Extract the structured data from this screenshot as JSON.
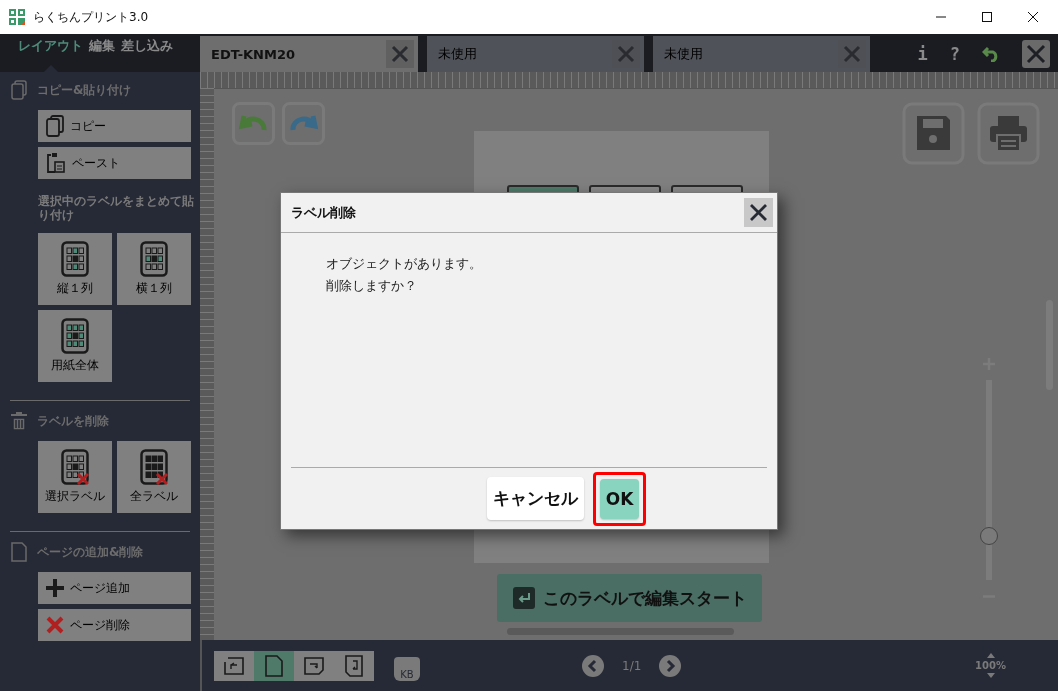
{
  "window": {
    "title": "らくちんプリント3.0"
  },
  "mode_tabs": [
    {
      "label": "レイアウト",
      "selected": true
    },
    {
      "label": "編集",
      "selected": false
    },
    {
      "label": "差し込み",
      "selected": false
    }
  ],
  "document_tabs": [
    {
      "label": "EDT-KNM20",
      "selected": true
    },
    {
      "label": "未使用",
      "selected": false
    },
    {
      "label": "未使用",
      "selected": false
    }
  ],
  "toolbar": [
    "i",
    "?"
  ],
  "sidebar": {
    "sections": [
      {
        "kind": "copy",
        "title": "コピー&貼り付け",
        "items": [
          {
            "kind": "copy",
            "label": "コピー"
          },
          {
            "kind": "paste",
            "label": "ペースト"
          },
          {
            "kind": "caption",
            "label": "選択中のラベルをまとめて貼り付け"
          },
          {
            "kind": "column",
            "label": "縦１列"
          },
          {
            "kind": "row",
            "label": "横１列"
          },
          {
            "kind": "sheet",
            "label": "用紙全体"
          }
        ]
      },
      {
        "kind": "delete",
        "title": "ラベルを削除",
        "items": [
          {
            "kind": "delete-selected",
            "label": "選択ラベル"
          },
          {
            "kind": "delete-all",
            "label": "全ラベル"
          }
        ]
      },
      {
        "kind": "page",
        "title": "ページの追加&削除",
        "items": [
          {
            "kind": "add-page",
            "label": "ページ追加"
          },
          {
            "kind": "delete-page",
            "label": "ページ削除"
          }
        ]
      }
    ]
  },
  "canvas": {
    "labels": [
      {
        "selected": true
      },
      {
        "selected": false
      },
      {
        "selected": false
      }
    ],
    "start_button": "このラベルで編集スタート",
    "zoom_slider": {
      "level": 0.22
    }
  },
  "bottom_bar": {
    "views": [
      {
        "selected": false
      },
      {
        "selected": true
      },
      {
        "selected": false
      },
      {
        "selected": false
      }
    ],
    "size_badge": "KB",
    "page": "1/1",
    "zoom": "100%"
  },
  "dialog": {
    "title": "ラベル削除",
    "message": [
      "オブジェクトがあります。",
      "削除しますか？"
    ],
    "buttons": [
      {
        "label": "キャンセル",
        "kind": "secondary",
        "highlighted": false
      },
      {
        "label": "OK",
        "kind": "primary",
        "highlighted": true
      }
    ]
  }
}
